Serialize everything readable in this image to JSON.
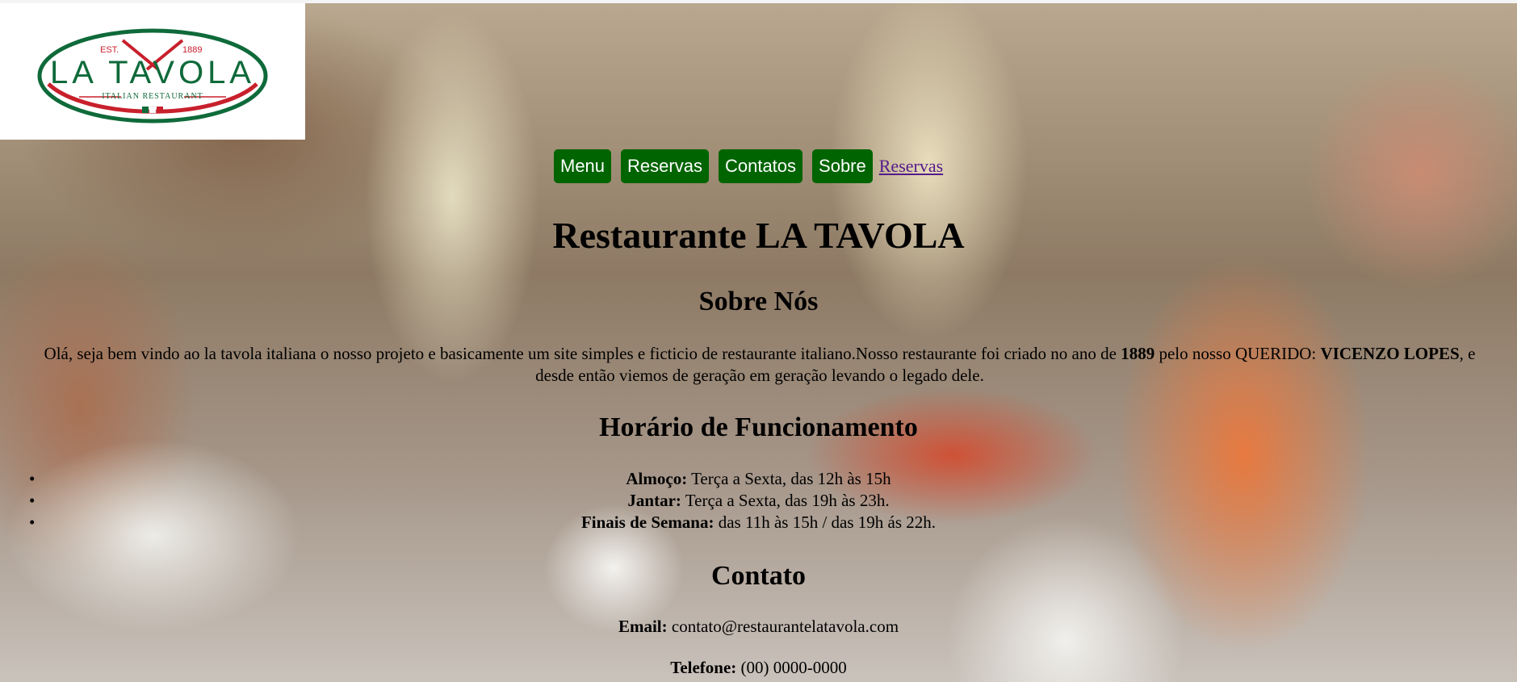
{
  "logo": {
    "est": "EST.",
    "year": "1889",
    "name": "LA TAVOLA",
    "tagline": "ITALIAN RESTAURANT",
    "colors": {
      "green": "#0f6a3a",
      "red": "#c8202c"
    }
  },
  "nav": {
    "items": [
      "Menu",
      "Reservas",
      "Contatos",
      "Sobre"
    ],
    "link": "Reservas",
    "button_color": "#006400"
  },
  "page_title": "Restaurante LA TAVOLA",
  "about": {
    "heading": "Sobre Nós",
    "text_1": "Olá, seja bem vindo ao la tavola italiana o nosso projeto e basicamente um site simples e ficticio de restaurante italiano.Nosso restaurante foi criado no ano de ",
    "year": "1889",
    "text_2": " pelo nosso QUERIDO: ",
    "founder": "VICENZO LOPES",
    "text_3": ", e desde então viemos de geração em geração levando o legado dele."
  },
  "hours": {
    "heading": "Horário de Funcionamento",
    "items": [
      {
        "label": "Almoço:",
        "value": " Terça a Sexta, das 12h às 15h"
      },
      {
        "label": "Jantar:",
        "value": " Terça a Sexta, das 19h às 23h."
      },
      {
        "label": "Finais de Semana:",
        "value": " das 11h às 15h / das 19h ás 22h."
      }
    ]
  },
  "contact": {
    "heading": "Contato",
    "email_label": "Email:",
    "email": " contato@restaurantelatavola.com",
    "phone_label": "Telefone:",
    "phone": " (00) 0000-0000"
  }
}
